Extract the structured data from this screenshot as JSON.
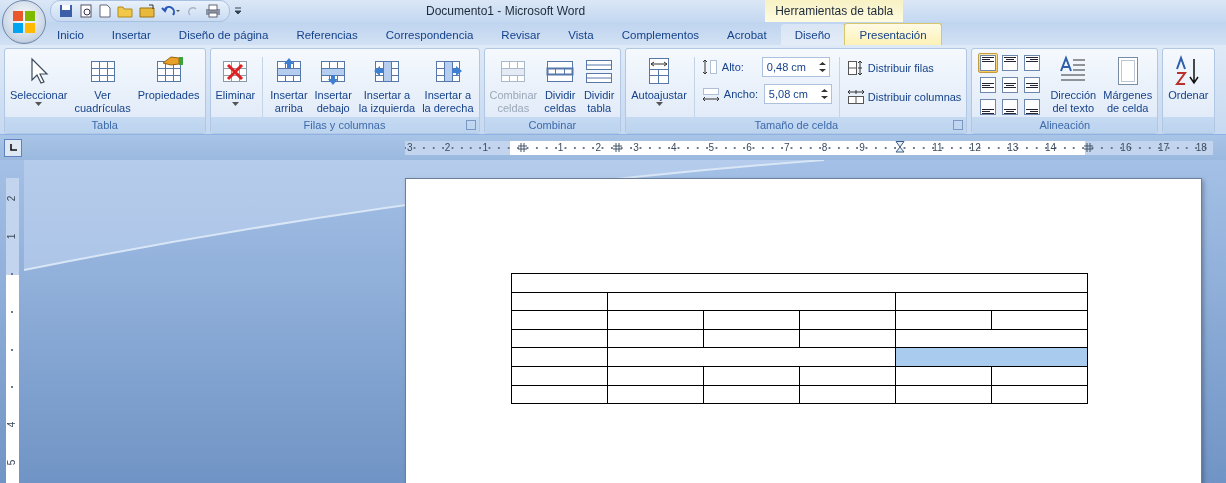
{
  "title_bar": {
    "title": "Documento1 - Microsoft Word",
    "contextual_title": "Herramientas de tabla"
  },
  "tabs": [
    {
      "label": "Inicio",
      "selected": false,
      "contextual": false
    },
    {
      "label": "Insertar",
      "selected": false,
      "contextual": false
    },
    {
      "label": "Diseño de página",
      "selected": false,
      "contextual": false
    },
    {
      "label": "Referencias",
      "selected": false,
      "contextual": false
    },
    {
      "label": "Correspondencia",
      "selected": false,
      "contextual": false
    },
    {
      "label": "Revisar",
      "selected": false,
      "contextual": false
    },
    {
      "label": "Vista",
      "selected": false,
      "contextual": false
    },
    {
      "label": "Complementos",
      "selected": false,
      "contextual": false
    },
    {
      "label": "Acrobat",
      "selected": false,
      "contextual": false
    },
    {
      "label": "Diseño",
      "selected": false,
      "contextual": true
    },
    {
      "label": "Presentación",
      "selected": true,
      "contextual": true
    }
  ],
  "ribbon": {
    "groups": [
      {
        "label": "Tabla",
        "launcher": false,
        "items": [
          {
            "kind": "large",
            "lines": [
              "Seleccionar"
            ],
            "dropdown": true,
            "disabled": false
          },
          {
            "kind": "large",
            "lines": [
              "Ver",
              "cuadrículas"
            ],
            "dropdown": false,
            "disabled": false
          },
          {
            "kind": "large",
            "lines": [
              "Propiedades"
            ],
            "dropdown": false,
            "disabled": false
          }
        ]
      },
      {
        "label": "Filas y columnas",
        "launcher": true,
        "items": [
          {
            "kind": "large",
            "lines": [
              "Eliminar"
            ],
            "dropdown": true,
            "disabled": false
          },
          {
            "kind": "separator"
          },
          {
            "kind": "large",
            "lines": [
              "Insertar",
              "arriba"
            ],
            "dropdown": false,
            "disabled": false
          },
          {
            "kind": "large",
            "lines": [
              "Insertar",
              "debajo"
            ],
            "dropdown": false,
            "disabled": false
          },
          {
            "kind": "large",
            "lines": [
              "Insertar a",
              "la izquierda"
            ],
            "dropdown": false,
            "disabled": false
          },
          {
            "kind": "large",
            "lines": [
              "Insertar a",
              "la derecha"
            ],
            "dropdown": false,
            "disabled": false
          }
        ]
      },
      {
        "label": "Combinar",
        "launcher": false,
        "items": [
          {
            "kind": "large",
            "lines": [
              "Combinar",
              "celdas"
            ],
            "dropdown": false,
            "disabled": true
          },
          {
            "kind": "large",
            "lines": [
              "Dividir",
              "celdas"
            ],
            "dropdown": false,
            "disabled": false
          },
          {
            "kind": "large",
            "lines": [
              "Dividir",
              "tabla"
            ],
            "dropdown": false,
            "disabled": false
          }
        ]
      },
      {
        "label": "Tamaño de celda",
        "launcher": true,
        "items": [
          {
            "kind": "large",
            "lines": [
              "Autoajustar"
            ],
            "dropdown": true,
            "disabled": false
          },
          {
            "kind": "separator"
          },
          {
            "kind": "spin-stack",
            "fields": [
              {
                "label": "Alto:",
                "value": "0,48 cm"
              },
              {
                "label": "Ancho:",
                "value": "5,08 cm"
              }
            ]
          },
          {
            "kind": "separator"
          },
          {
            "kind": "small-stack",
            "buttons": [
              {
                "label": "Distribuir filas"
              },
              {
                "label": "Distribuir columnas"
              }
            ]
          }
        ]
      },
      {
        "label": "Alineación",
        "launcher": false,
        "items": [
          {
            "kind": "align-grid",
            "cells": [
              {
                "selected": true
              },
              {
                "selected": false
              },
              {
                "selected": false
              },
              {
                "selected": false
              },
              {
                "selected": false
              },
              {
                "selected": false
              },
              {
                "selected": false
              },
              {
                "selected": false
              },
              {
                "selected": false
              }
            ]
          },
          {
            "kind": "large",
            "lines": [
              "Dirección",
              "del texto"
            ],
            "dropdown": false,
            "disabled": false
          },
          {
            "kind": "large",
            "lines": [
              "Márgenes",
              "de celda"
            ],
            "dropdown": false,
            "disabled": false
          }
        ]
      },
      {
        "launcher": false,
        "items": [
          {
            "kind": "large",
            "lines": [
              "Ordenar"
            ],
            "dropdown": false,
            "disabled": false
          }
        ]
      }
    ]
  },
  "ruler": {
    "items": [
      {
        "kind": "num",
        "label": "3"
      },
      {
        "kind": "num",
        "label": "2"
      },
      {
        "kind": "num",
        "label": "1"
      },
      {
        "kind": "marker"
      },
      {
        "kind": "num",
        "label": "1"
      },
      {
        "kind": "num",
        "label": "2"
      },
      {
        "kind": "split"
      },
      {
        "kind": "num",
        "label": "3"
      },
      {
        "kind": "num",
        "label": "4"
      },
      {
        "kind": "num",
        "label": "5"
      },
      {
        "kind": "num",
        "label": "6"
      },
      {
        "kind": "num",
        "label": "7"
      },
      {
        "kind": "num",
        "label": "8"
      },
      {
        "kind": "num",
        "label": "9"
      },
      {
        "kind": "indent"
      },
      {
        "kind": "num",
        "label": "11"
      },
      {
        "kind": "num",
        "label": "12"
      },
      {
        "kind": "num",
        "label": "13"
      },
      {
        "kind": "num",
        "label": "14"
      },
      {
        "kind": "marker"
      },
      {
        "kind": "num",
        "label": "16"
      },
      {
        "kind": "num",
        "label": "17"
      },
      {
        "kind": "num",
        "label": "18"
      }
    ]
  },
  "vertical_ruler": {
    "items": [
      {
        "kind": "num",
        "label": "2"
      },
      {
        "kind": "num",
        "label": "1"
      },
      {
        "kind": "tick"
      },
      {
        "kind": "tick"
      },
      {
        "kind": "tick"
      },
      {
        "kind": "tick"
      },
      {
        "kind": "num",
        "label": "4"
      },
      {
        "kind": "num",
        "label": "5"
      }
    ]
  },
  "document": {
    "table": {
      "rows": [
        {
          "cells": [
            {
              "kind": "full",
              "selected": false
            }
          ]
        },
        {
          "cells": [
            {
              "kind": "single",
              "selected": false
            },
            {
              "kind": "triple",
              "selected": false
            },
            {
              "kind": "double",
              "selected": false
            }
          ]
        },
        {
          "cells": [
            {
              "kind": "single",
              "selected": false
            },
            {
              "kind": "single",
              "selected": false
            },
            {
              "kind": "single",
              "selected": false
            },
            {
              "kind": "single",
              "selected": false
            },
            {
              "kind": "single",
              "selected": false
            },
            {
              "kind": "single",
              "selected": false
            }
          ]
        },
        {
          "cells": [
            {
              "kind": "single",
              "selected": false
            },
            {
              "kind": "single",
              "selected": false
            },
            {
              "kind": "single",
              "selected": false
            },
            {
              "kind": "single",
              "selected": false
            },
            {
              "kind": "double",
              "selected": false
            }
          ]
        },
        {
          "cells": [
            {
              "kind": "single",
              "selected": false
            },
            {
              "kind": "triple",
              "selected": false
            },
            {
              "kind": "double",
              "selected": true
            }
          ]
        },
        {
          "cells": [
            {
              "kind": "single",
              "selected": false
            },
            {
              "kind": "single",
              "selected": false
            },
            {
              "kind": "single",
              "selected": false
            },
            {
              "kind": "single",
              "selected": false
            },
            {
              "kind": "single",
              "selected": false
            },
            {
              "kind": "single",
              "selected": false
            }
          ]
        },
        {
          "cells": [
            {
              "kind": "single",
              "selected": false
            },
            {
              "kind": "single",
              "selected": false
            },
            {
              "kind": "single",
              "selected": false
            },
            {
              "kind": "single",
              "selected": false
            },
            {
              "kind": "single",
              "selected": false
            },
            {
              "kind": "single",
              "selected": false
            }
          ]
        }
      ]
    }
  }
}
